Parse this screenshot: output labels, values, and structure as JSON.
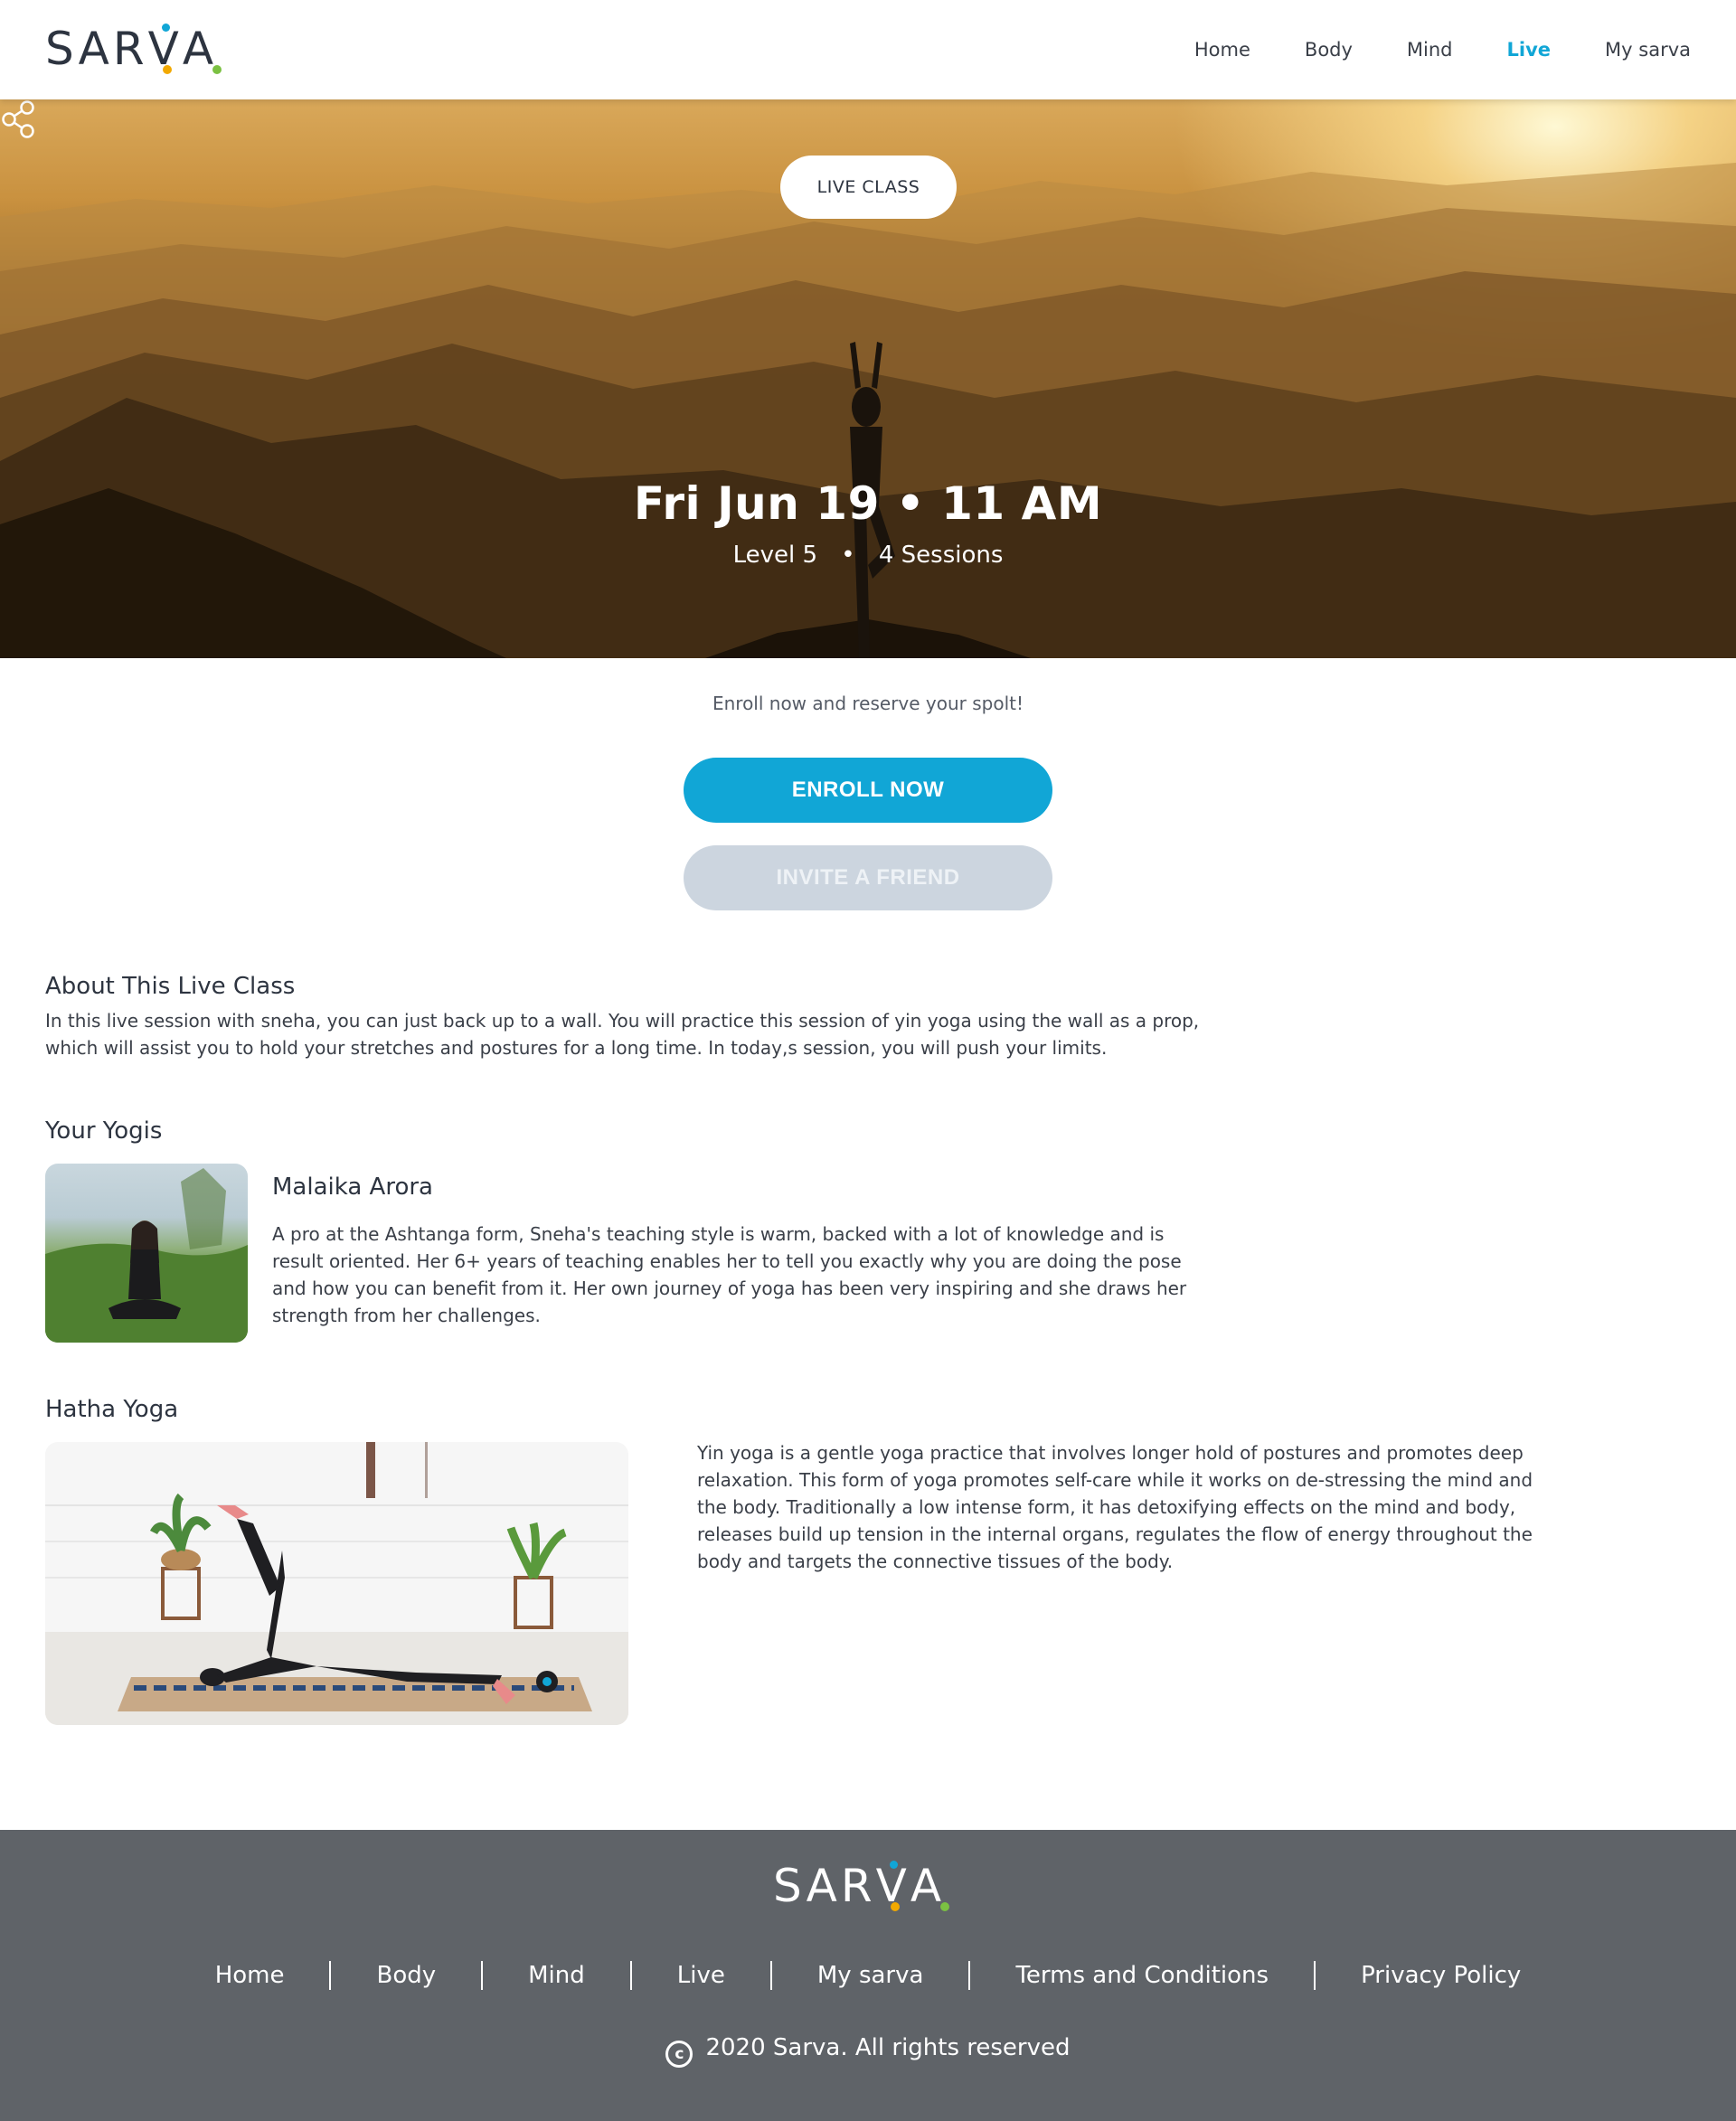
{
  "brand": {
    "logo_prefix": "SAR",
    "logo_v": "V",
    "logo_suffix": "A",
    "dot_colors": [
      "#f2a900",
      "#11a6d6",
      "#7bc142"
    ],
    "accent": "#11a6d6"
  },
  "nav": {
    "items": [
      {
        "label": "Home"
      },
      {
        "label": "Body"
      },
      {
        "label": "Mind"
      },
      {
        "label": "Live",
        "active": true
      },
      {
        "label": "My sarva"
      }
    ]
  },
  "hero": {
    "badge": "LIVE CLASS",
    "title": "Fri Jun 19 • 11 AM",
    "level": "Level 5",
    "separator": "•",
    "sessions": "4 Sessions",
    "share_icon": "share-icon"
  },
  "enroll": {
    "prompt": "Enroll now and reserve your spolt!",
    "enroll_label": "ENROLL NOW",
    "invite_label": "INVITE A FRIEND"
  },
  "about": {
    "title": "About This Live Class",
    "text": "In this live session with sneha, you can just back up to a wall. You will practice this session of yin yoga using the wall as a prop, which will assist you to hold your stretches and postures for a long time. In today,s session, you will push your limits."
  },
  "yogis": {
    "title": "Your Yogis",
    "items": [
      {
        "name": "Malaika Arora",
        "bio": "A pro at the Ashtanga form, Sneha's teaching style is warm, backed with a lot of knowledge and is result oriented. Her 6+ years of teaching enables her to tell you exactly why you are doing the pose and how you can benefit from it. Her own journey of yoga has been very inspiring and she draws her strength from her challenges."
      }
    ]
  },
  "style": {
    "title": "Hatha Yoga",
    "text": "Yin yoga is a gentle yoga practice that involves longer hold of postures and promotes deep relaxation. This form of yoga promotes self-care while it works on de-stressing the mind and the body. Traditionally a low intense form, it has detoxifying effects on the mind and body, releases build up tension in the internal organs, regulates the flow of energy throughout the body and targets the connective tissues of the body."
  },
  "footer": {
    "links": [
      {
        "label": "Home"
      },
      {
        "label": "Body"
      },
      {
        "label": "Mind"
      },
      {
        "label": "Live"
      },
      {
        "label": "My sarva"
      },
      {
        "label": "Terms and Conditions"
      },
      {
        "label": "Privacy Policy"
      }
    ],
    "copyright_symbol": "c",
    "copyright": "2020 Sarva. All rights reserved"
  }
}
